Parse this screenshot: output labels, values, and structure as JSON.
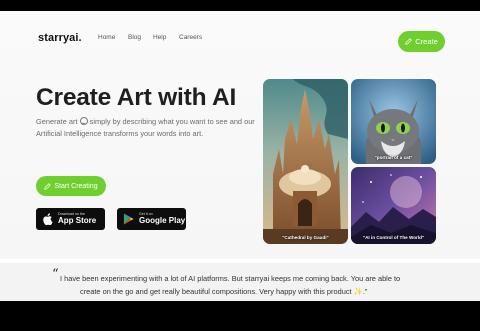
{
  "nav": {
    "logo": "starryai.",
    "links": [
      "Home",
      "Blog",
      "Help",
      "Careers"
    ],
    "create_label": "Create"
  },
  "hero": {
    "title": "Create Art with AI",
    "subtitle_part1": "Generate art",
    "subtitle_part2": "simply by describing what you want to see and our Artificial Intelligence transforms your words into art.",
    "cta_label": "Start Creating"
  },
  "stores": {
    "apple_small": "Download on the",
    "apple_big": "App Store",
    "google_small": "Get it on",
    "google_big": "Google Play"
  },
  "gallery": {
    "cathedral_caption": "\"Cathedral by Gaudi\"",
    "cat_caption": "\"portrait of a cat\"",
    "ai_caption": "\"AI in Control of The World\""
  },
  "testimonial": {
    "quote_mark": "“",
    "line1": "I have been experimenting with a lot of AI platforms. But starryai keeps me coming back. You are able to",
    "line2": "create on the go and get really beautiful compositions. Very happy with this product ✨.”"
  },
  "colors": {
    "accent": "#6fcf2f",
    "dark": "#1f1f1f",
    "store_bg": "#0d0d0d"
  },
  "icons": [
    "pencil-icon",
    "apple-icon",
    "google-play-icon",
    "smiley-icon"
  ]
}
